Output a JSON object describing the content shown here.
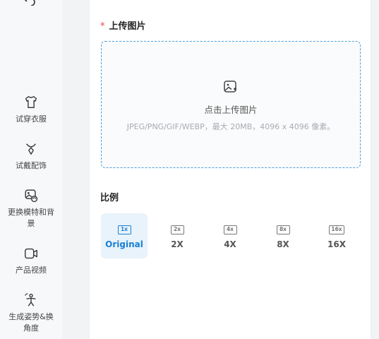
{
  "sidebar": {
    "items": [
      {
        "label": "试穿衣服",
        "icon": "shirt-icon"
      },
      {
        "label": "试戴配饰",
        "icon": "necklace-icon"
      },
      {
        "label": "更换模特和背景",
        "icon": "image-swap-icon"
      },
      {
        "label": "产品视频",
        "icon": "video-icon"
      },
      {
        "label": "生成姿势&换角度",
        "icon": "pose-icon"
      }
    ]
  },
  "upload": {
    "required_mark": "*",
    "title": "上传图片",
    "prompt": "点击上传图片",
    "hint": "JPEG/PNG/GIF/WEBP，最大 20MB，4096 x 4096 像素。"
  },
  "ratio": {
    "title": "比例",
    "options": [
      {
        "badge": "1x",
        "label": "Original",
        "selected": true
      },
      {
        "badge": "2x",
        "label": "2X",
        "selected": false
      },
      {
        "badge": "4x",
        "label": "4X",
        "selected": false
      },
      {
        "badge": "8x",
        "label": "8X",
        "selected": false
      },
      {
        "badge": "16x",
        "label": "16X",
        "selected": false
      }
    ]
  },
  "colors": {
    "accent": "#1a7fd4",
    "required": "#e5484d",
    "selected_bg": "#e8f3fb"
  }
}
